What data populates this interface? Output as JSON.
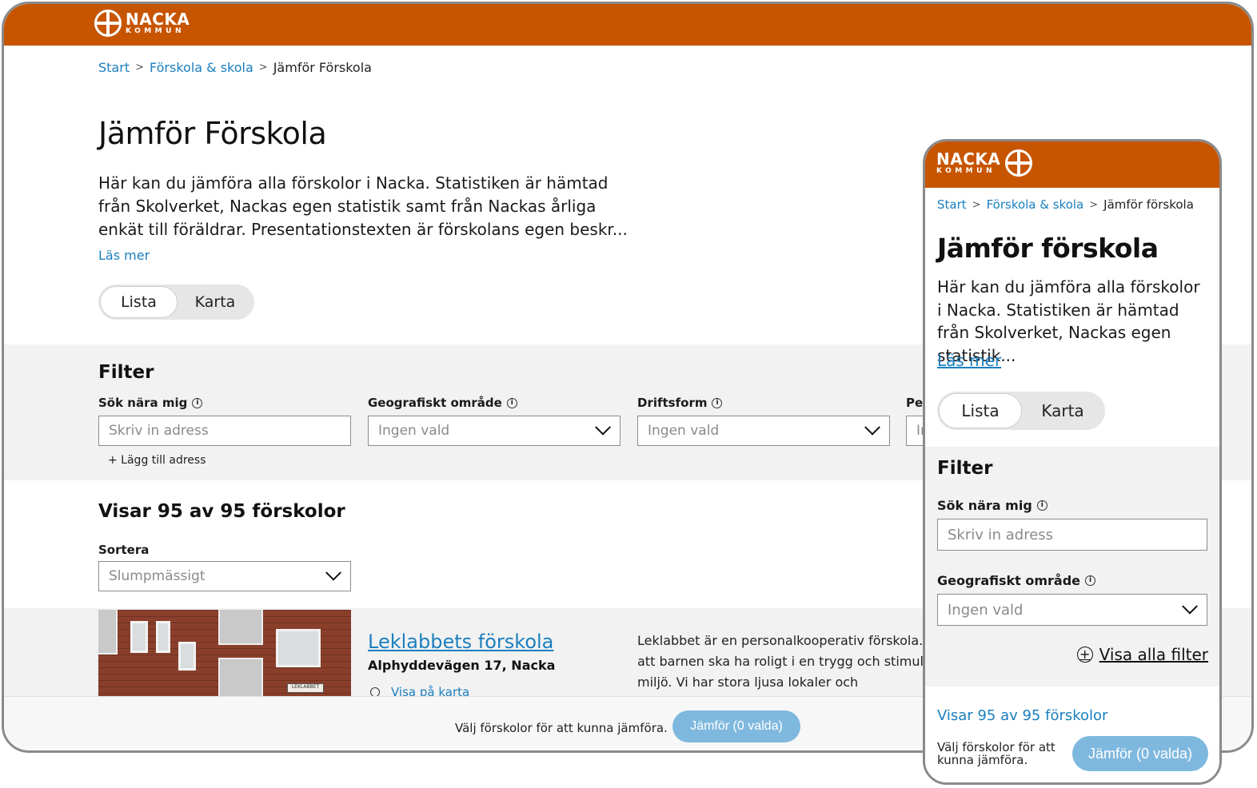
{
  "brand": {
    "name": "NACKA",
    "sub": "KOMMUN",
    "color": "#c75500",
    "link_color": "#1b7fbf",
    "button_color": "#7fb8de"
  },
  "desktop": {
    "breadcrumb": {
      "items": [
        "Start",
        "Förskola & skola"
      ],
      "current": "Jämför Förskola"
    },
    "title": "Jämför Förskola",
    "intro": "Här kan du jämföra alla förskolor i Nacka. Statistiken är hämtad från Skolverket, Nackas egen statistik samt från Nackas årliga enkät till föräldrar. Presentationstexten är förskolans egen beskr...",
    "read_more": "Läs mer",
    "view_toggle": {
      "list": "Lista",
      "map": "Karta",
      "active": "Lista"
    },
    "filter": {
      "title": "Filter",
      "near_me": {
        "label": "Sök nära mig",
        "placeholder": "Skriv in adress"
      },
      "area": {
        "label": "Geografiskt område",
        "value": "Ingen vald"
      },
      "operation": {
        "label": "Driftsform",
        "value": "Ingen vald"
      },
      "pedagogy": {
        "label": "Ped",
        "value": "In"
      },
      "add_address": "+ Lägg till adress"
    },
    "results": {
      "title": "Visar 95 av 95 förskolor",
      "sort_label": "Sortera",
      "sort_value": "Slumpmässigt"
    },
    "card": {
      "name": "Leklabbets förskola",
      "address": "Alphyddevägen 17, Nacka",
      "map_link": "Visa på karta",
      "description": "Leklabbet är en personalkooperativ förskola. Vi vill att barnen ska ha roligt i en trygg och stimulerande miljö. Vi har stora ljusa lokaler och",
      "sign_text": "LEKLABBET"
    },
    "footer": {
      "text": "Välj förskolor för att kunna jämföra.",
      "button": "Jämför (0 valda)"
    }
  },
  "mobile": {
    "breadcrumb": {
      "items": [
        "Start",
        "Förskola & skola"
      ],
      "current": "Jämför förskola"
    },
    "title": "Jämför förskola",
    "intro": "Här kan du jämföra alla förskolor i Nacka. Statistiken är hämtad från Skolverket, Nackas egen statistik...",
    "read_more": "Läs mer",
    "view_toggle": {
      "list": "Lista",
      "map": "Karta",
      "active": "Lista"
    },
    "filter": {
      "title": "Filter",
      "near_me": {
        "label": "Sök nära mig",
        "placeholder": "Skriv in adress"
      },
      "area": {
        "label": "Geografiskt område",
        "value": "Ingen vald"
      },
      "show_all": "Visa alla filter"
    },
    "results": "Visar 95 av 95 förskolor",
    "footer": {
      "text": "Välj förskolor för att kunna jämföra.",
      "button": "Jämför (0 valda)"
    }
  }
}
